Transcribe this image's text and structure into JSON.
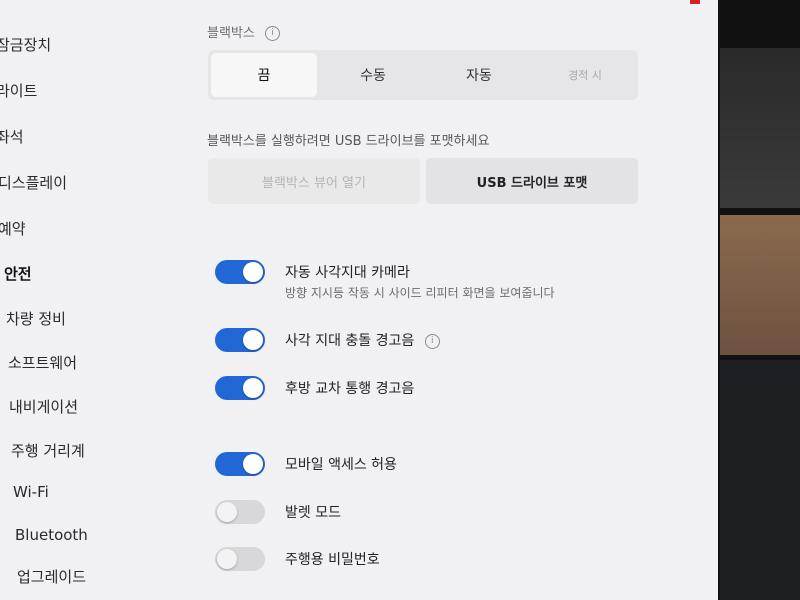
{
  "sidebar": {
    "items": [
      {
        "label": "잠금장치"
      },
      {
        "label": "라이트"
      },
      {
        "label": "좌석"
      },
      {
        "label": "디스플레이"
      },
      {
        "label": "예약"
      },
      {
        "label": "안전",
        "active": true
      },
      {
        "label": "차량 정비"
      },
      {
        "label": "소프트웨어"
      },
      {
        "label": "내비게이션"
      },
      {
        "label": "주행 거리계"
      },
      {
        "label": "Wi-Fi"
      },
      {
        "label": "Bluetooth"
      },
      {
        "label": "업그레이드"
      }
    ]
  },
  "dashcam": {
    "title": "블랙박스",
    "info_icon": "i",
    "options": [
      "끔",
      "수동",
      "자동",
      "경적 시"
    ],
    "selected": "끔",
    "helper": "블랙박스를 실행하려면 USB 드라이브를 포맷하세요",
    "buttons": {
      "left": "블랙박스 뷰어 열기",
      "format": "USB 드라이브 포맷"
    }
  },
  "toggles": [
    {
      "label": "자동 사각지대 카메라",
      "sub": "방향 지시등 작동 시 사이드 리피터 화면을 보여줍니다",
      "on": true
    },
    {
      "label": "사각 지대 충돌 경고음",
      "info": "i",
      "on": true
    },
    {
      "label": "후방 교차 통행 경고음",
      "on": true
    },
    {
      "label": "모바일 액세스 허용",
      "on": true
    },
    {
      "label": "발렛 모드",
      "on": false
    },
    {
      "label": "주행용 비밀번호",
      "on": false
    }
  ],
  "colors": {
    "accent": "#2366d6",
    "screen_bg": "#f1f1f3",
    "toggle_off": "#d8d8da"
  }
}
